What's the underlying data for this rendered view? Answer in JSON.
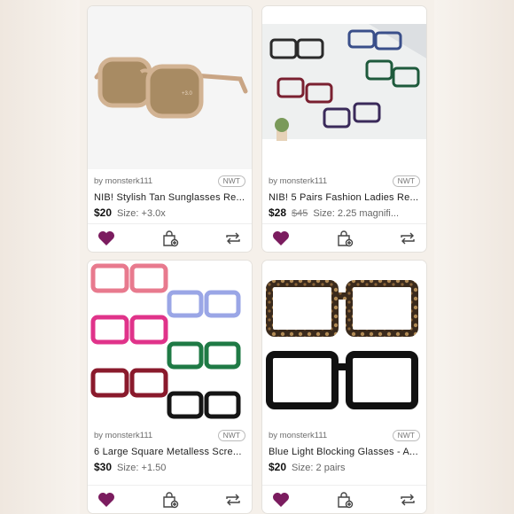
{
  "listings": [
    {
      "seller": "by monsterk111",
      "badge": "NWT",
      "title": "NIB! Stylish Tan Sunglasses Re...",
      "price": "$20",
      "original_price": "",
      "size": "Size: +3.0x"
    },
    {
      "seller": "by monsterk111",
      "badge": "NWT",
      "title": "NIB! 5 Pairs Fashion Ladies Re...",
      "price": "$28",
      "original_price": "$45",
      "size": "Size: 2.25 magnifi..."
    },
    {
      "seller": "by monsterk111",
      "badge": "NWT",
      "title": "6 Large Square Metalless Scre...",
      "price": "$30",
      "original_price": "",
      "size": "Size: +1.50"
    },
    {
      "seller": "by monsterk111",
      "badge": "NWT",
      "title": "Blue Light Blocking Glasses - A...",
      "price": "$20",
      "original_price": "",
      "size": "Size: 2 pairs"
    }
  ],
  "icons": {
    "like": "heart-icon",
    "bundle": "shopping-bag-add-icon",
    "share": "share-repost-icon"
  },
  "colors": {
    "heart": "#7b1c5f",
    "icon": "#444444"
  }
}
